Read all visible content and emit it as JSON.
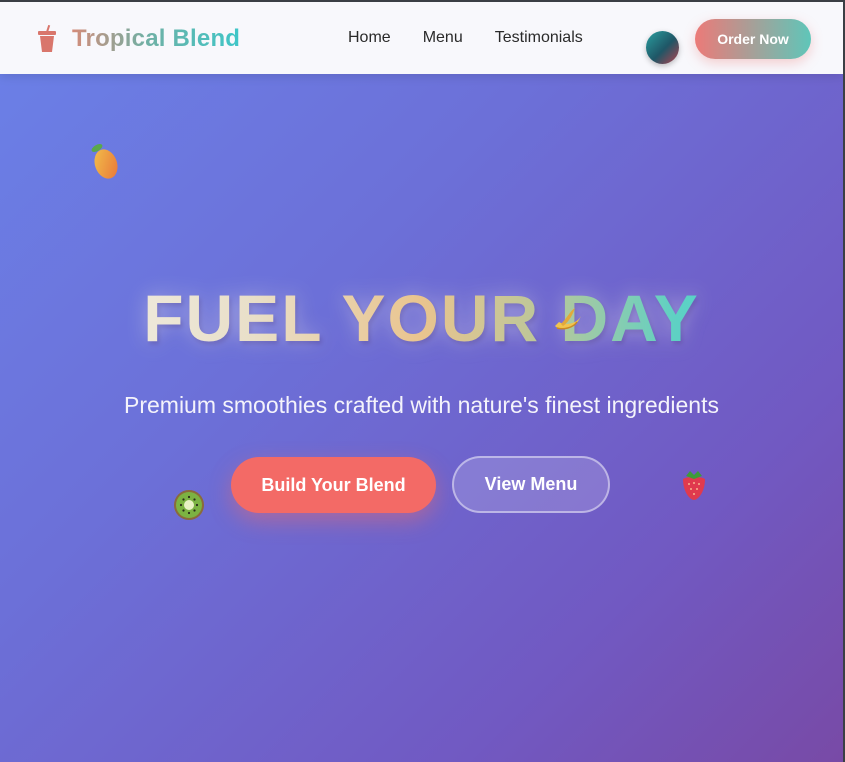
{
  "brand": {
    "name": "Tropical Blend",
    "icon": "smoothie-cup-icon"
  },
  "nav": {
    "items": [
      "Home",
      "Menu",
      "Testimonials"
    ]
  },
  "header": {
    "theme_toggle_icon": "theme-toggle-circle",
    "order_button": "Order Now"
  },
  "hero": {
    "title": "FUEL YOUR DAY",
    "subtitle": "Premium smoothies crafted with nature's finest ingredients",
    "primary_button": "Build Your Blend",
    "secondary_button": "View Menu",
    "decorations": [
      "mango-icon",
      "banana-icon",
      "kiwi-icon",
      "strawberry-icon"
    ]
  },
  "colors": {
    "primary_coral": "#f36a66",
    "accent_teal": "#5fc6b9",
    "hero_gradient_start": "#6b7fe6",
    "hero_gradient_end": "#784aa6"
  }
}
